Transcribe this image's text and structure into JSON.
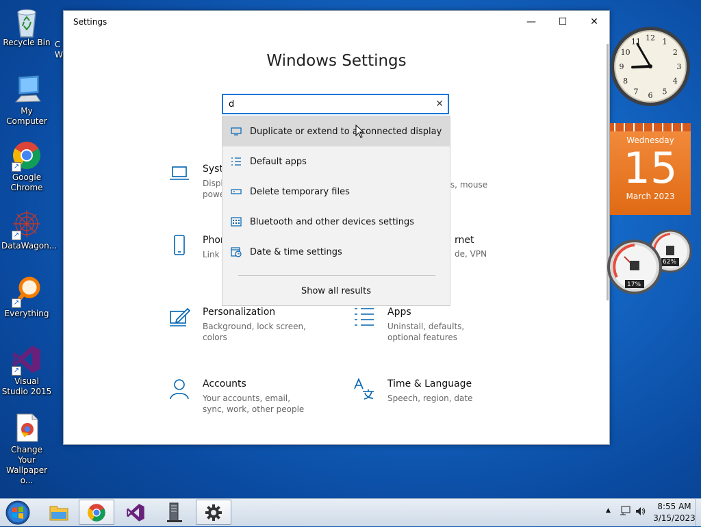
{
  "desktop": {
    "icons": [
      {
        "label": "Recycle Bin",
        "icon": "recycle-bin-icon"
      },
      {
        "label": "My Computer",
        "icon": "computer-icon"
      },
      {
        "label": "Google Chrome",
        "icon": "chrome-icon"
      },
      {
        "label": "DataWagon...",
        "icon": "datawagon-icon"
      },
      {
        "label": "Everything",
        "icon": "everything-search-icon"
      },
      {
        "label": "Visual Studio 2015",
        "icon": "visual-studio-icon"
      },
      {
        "label": "Change Your Wallpaper o...",
        "icon": "wallpaper-file-icon"
      }
    ],
    "partial_label": "C W"
  },
  "window": {
    "title": "Settings",
    "heading": "Windows Settings",
    "controls": {
      "minimize": "—",
      "maximize": "☐",
      "close": "✕"
    }
  },
  "search": {
    "value": "d",
    "clear_glyph": "✕",
    "suggestions": [
      {
        "label": "Duplicate or extend to a connected display",
        "icon": "display-icon",
        "highlighted": true
      },
      {
        "label": "Default apps",
        "icon": "default-apps-icon",
        "highlighted": false
      },
      {
        "label": "Delete temporary files",
        "icon": "storage-icon",
        "highlighted": false
      },
      {
        "label": "Bluetooth and other devices settings",
        "icon": "devices-icon",
        "highlighted": false
      },
      {
        "label": "Date & time settings",
        "icon": "date-time-icon",
        "highlighted": false
      }
    ],
    "show_all": "Show all results"
  },
  "categories": [
    {
      "title": "Syste",
      "desc": "Displa powe",
      "icon": "laptop-icon"
    },
    {
      "title": "",
      "desc": "rs, mouse",
      "icon": ""
    },
    {
      "title": "Phon",
      "desc": "Link y",
      "icon": "phone-icon"
    },
    {
      "title": "rnet",
      "desc": "de, VPN",
      "icon": ""
    },
    {
      "title": "Personalization",
      "desc": "Background, lock screen, colors",
      "icon": "personalization-icon"
    },
    {
      "title": "Apps",
      "desc": "Uninstall, defaults, optional features",
      "icon": "apps-icon"
    },
    {
      "title": "Accounts",
      "desc": "Your accounts, email, sync, work, other people",
      "icon": "accounts-icon"
    },
    {
      "title": "Time & Language",
      "desc": "Speech, region, date",
      "icon": "time-language-icon"
    }
  ],
  "gadgets": {
    "clock": {
      "time": "8:55",
      "numerals": [
        "12",
        "1",
        "2",
        "3",
        "4",
        "5",
        "6",
        "7",
        "8",
        "9",
        "10",
        "11"
      ]
    },
    "calendar": {
      "weekday": "Wednesday",
      "day": "15",
      "month_year": "March 2023"
    },
    "meters": {
      "cpu": "17%",
      "memory": "62%"
    }
  },
  "taskbar": {
    "apps": [
      {
        "name": "explorer",
        "icon": "folder-icon",
        "active": false
      },
      {
        "name": "chrome",
        "icon": "chrome-icon",
        "active": true
      },
      {
        "name": "visual-studio",
        "icon": "visual-studio-icon",
        "active": false
      },
      {
        "name": "file-server",
        "icon": "server-icon",
        "active": false
      },
      {
        "name": "settings",
        "icon": "gear-icon",
        "active": true
      }
    ],
    "tray": {
      "up_arrow": "▲",
      "time": "8:55 AM",
      "date": "3/15/2023"
    }
  },
  "colors": {
    "accent": "#0078d7",
    "calendar_orange": "#e8701e"
  }
}
